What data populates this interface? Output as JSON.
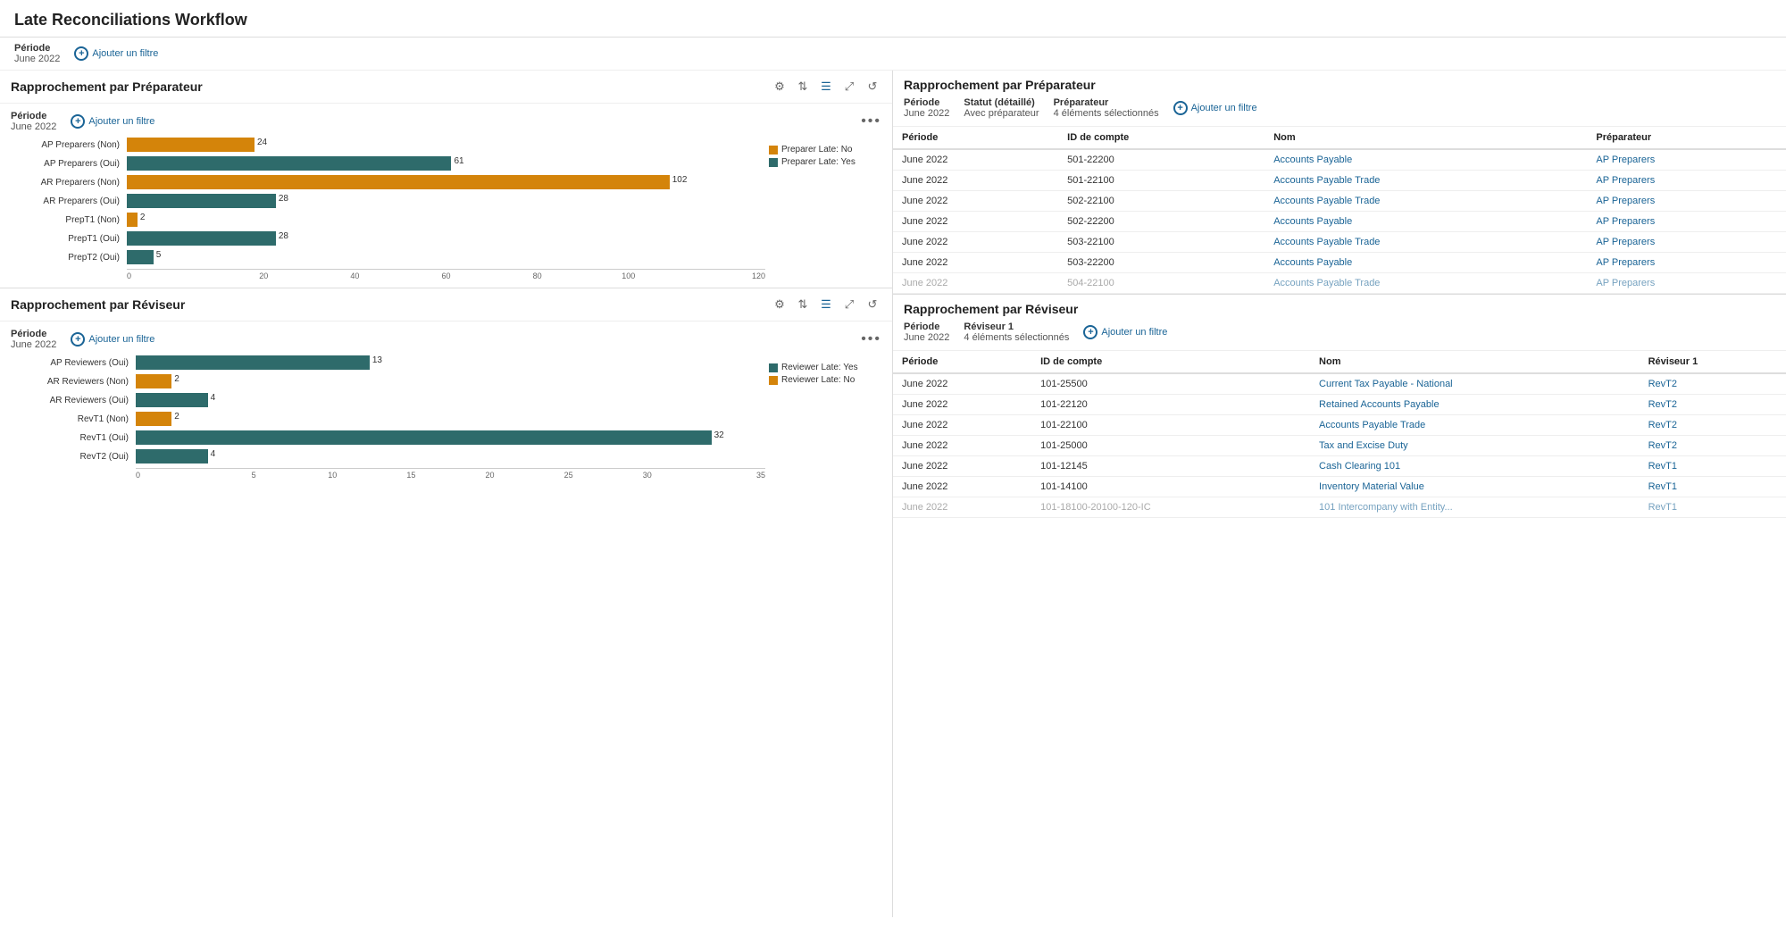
{
  "page": {
    "title": "Late Reconciliations Workflow"
  },
  "global_filter": {
    "period_label": "Période",
    "period_value": "June 2022",
    "add_filter_label": "Ajouter un filtre"
  },
  "preparateur_chart": {
    "section_title": "Rapprochement par Préparateur",
    "period_label": "Période",
    "period_value": "June 2022",
    "add_filter_label": "Ajouter un filtre",
    "legend": [
      {
        "label": "Preparer Late: No",
        "color": "#d4840a"
      },
      {
        "label": "Preparer Late: Yes",
        "color": "#2e6b6b"
      }
    ],
    "bars": [
      {
        "label": "AP Preparers (Non)",
        "orange": 24,
        "teal": 0,
        "orange_val": 24,
        "teal_val": null
      },
      {
        "label": "AP Preparers (Oui)",
        "orange": 0,
        "teal": 61,
        "orange_val": null,
        "teal_val": 61
      },
      {
        "label": "AR Preparers (Non)",
        "orange": 102,
        "teal": 0,
        "orange_val": 102,
        "teal_val": null
      },
      {
        "label": "AR Preparers (Oui)",
        "orange": 0,
        "teal": 28,
        "orange_val": null,
        "teal_val": 28
      },
      {
        "label": "PrepT1 (Non)",
        "orange": 2,
        "teal": 0,
        "orange_val": 2,
        "teal_val": null
      },
      {
        "label": "PrepT1 (Oui)",
        "orange": 0,
        "teal": 28,
        "orange_val": null,
        "teal_val": 28
      },
      {
        "label": "PrepT2 (Oui)",
        "orange": 0,
        "teal": 5,
        "orange_val": null,
        "teal_val": 5
      }
    ],
    "axis_ticks": [
      "0",
      "20",
      "40",
      "60",
      "80",
      "100",
      "120"
    ],
    "max": 120
  },
  "preparateur_table": {
    "section_title": "Rapprochement par Préparateur",
    "filters": [
      {
        "label": "Période",
        "value": "June 2022"
      },
      {
        "label": "Statut (détaillé)",
        "value": "Avec préparateur"
      },
      {
        "label": "Préparateur",
        "value": "4 éléments sélectionnés"
      }
    ],
    "add_filter_label": "Ajouter un filtre",
    "columns": [
      "Période",
      "ID de compte",
      "Nom",
      "Préparateur"
    ],
    "rows": [
      {
        "period": "June 2022",
        "id": "501-22200",
        "nom": "Accounts Payable",
        "preparateur": "AP Preparers"
      },
      {
        "period": "June 2022",
        "id": "501-22100",
        "nom": "Accounts Payable Trade",
        "preparateur": "AP Preparers"
      },
      {
        "period": "June 2022",
        "id": "502-22100",
        "nom": "Accounts Payable Trade",
        "preparateur": "AP Preparers"
      },
      {
        "period": "June 2022",
        "id": "502-22200",
        "nom": "Accounts Payable",
        "preparateur": "AP Preparers"
      },
      {
        "period": "June 2022",
        "id": "503-22100",
        "nom": "Accounts Payable Trade",
        "preparateur": "AP Preparers"
      },
      {
        "period": "June 2022",
        "id": "503-22200",
        "nom": "Accounts Payable",
        "preparateur": "AP Preparers"
      },
      {
        "period": "June 2022",
        "id": "504-22100",
        "nom": "Accounts Payable Trade",
        "preparateur": "AP Preparers"
      }
    ]
  },
  "reviseur_chart": {
    "section_title": "Rapprochement par Réviseur",
    "period_label": "Période",
    "period_value": "June 2022",
    "add_filter_label": "Ajouter un filtre",
    "legend": [
      {
        "label": "Reviewer Late: Yes",
        "color": "#2e6b6b"
      },
      {
        "label": "Reviewer Late: No",
        "color": "#d4840a"
      }
    ],
    "bars": [
      {
        "label": "AP Reviewers (Oui)",
        "orange": 0,
        "teal": 13,
        "orange_val": null,
        "teal_val": 13
      },
      {
        "label": "AR Reviewers (Non)",
        "orange": 2,
        "teal": 0,
        "orange_val": 2,
        "teal_val": null
      },
      {
        "label": "AR Reviewers (Oui)",
        "orange": 0,
        "teal": 4,
        "orange_val": null,
        "teal_val": 4
      },
      {
        "label": "RevT1 (Non)",
        "orange": 2,
        "teal": 0,
        "orange_val": 2,
        "teal_val": null
      },
      {
        "label": "RevT1 (Oui)",
        "orange": 0,
        "teal": 32,
        "orange_val": null,
        "teal_val": 32
      },
      {
        "label": "RevT2 (Oui)",
        "orange": 0,
        "teal": 4,
        "orange_val": null,
        "teal_val": 4
      }
    ],
    "axis_ticks": [
      "0",
      "5",
      "10",
      "15",
      "20",
      "25",
      "30",
      "35"
    ],
    "max": 35
  },
  "reviseur_table": {
    "section_title": "Rapprochement par Réviseur",
    "filters": [
      {
        "label": "Période",
        "value": "June 2022"
      },
      {
        "label": "Réviseur 1",
        "value": "4 éléments sélectionnés"
      }
    ],
    "add_filter_label": "Ajouter un filtre",
    "columns": [
      "Période",
      "ID de compte",
      "Nom",
      "Réviseur 1"
    ],
    "rows": [
      {
        "period": "June 2022",
        "id": "101-25500",
        "nom": "Current Tax Payable - National",
        "reviseur": "RevT2"
      },
      {
        "period": "June 2022",
        "id": "101-22120",
        "nom": "Retained Accounts Payable",
        "reviseur": "RevT2"
      },
      {
        "period": "June 2022",
        "id": "101-22100",
        "nom": "Accounts Payable Trade",
        "reviseur": "RevT2"
      },
      {
        "period": "June 2022",
        "id": "101-25000",
        "nom": "Tax and Excise Duty",
        "reviseur": "RevT2"
      },
      {
        "period": "June 2022",
        "id": "101-12145",
        "nom": "Cash Clearing 101",
        "reviseur": "RevT1"
      },
      {
        "period": "June 2022",
        "id": "101-14100",
        "nom": "Inventory Material Value",
        "reviseur": "RevT1"
      },
      {
        "period": "June 2022",
        "id": "101-18100-20100-120-IC",
        "nom": "101 Intercompany with Entity...",
        "reviseur": "RevT1"
      }
    ]
  },
  "toolbar": {
    "icon1": "⚙",
    "icon2": "⇅",
    "icon3": "≡",
    "icon4": "⤢",
    "icon5": "↺"
  }
}
